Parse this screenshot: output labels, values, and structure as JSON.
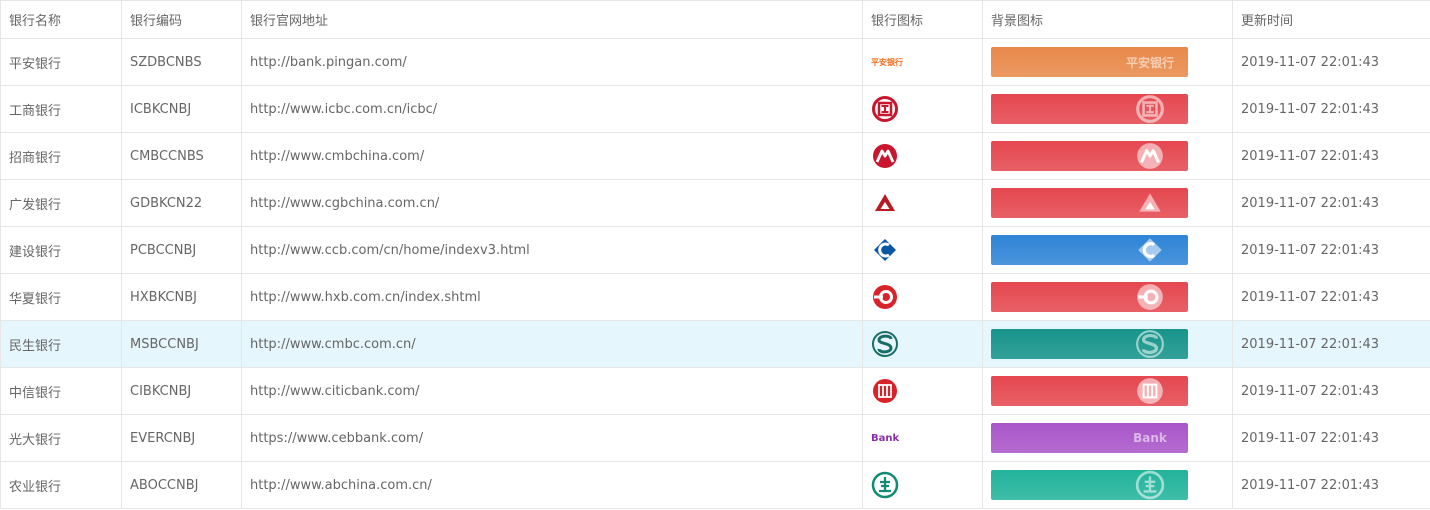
{
  "columns": [
    "银行名称",
    "银行编码",
    "银行官网地址",
    "银行图标",
    "背景图标",
    "更新时间"
  ],
  "rows": [
    {
      "name": "平安银行",
      "code": "SZDBCNBS",
      "url": "http://bank.pingan.com/",
      "icon": "pingan-logo-icon",
      "bg_color": "#e8894a",
      "time": "2019-11-07 22:01:43",
      "logo_text": "平安银行",
      "bg_text": "平安银行"
    },
    {
      "name": "工商银行",
      "code": "ICBKCNBJ",
      "url": "http://www.icbc.com.cn/icbc/",
      "icon": "icbc-logo-icon",
      "bg_color": "#e5474f",
      "time": "2019-11-07 22:01:43"
    },
    {
      "name": "招商银行",
      "code": "CMBCCNBS",
      "url": "http://www.cmbchina.com/",
      "icon": "cmb-logo-icon",
      "bg_color": "#e5474f",
      "time": "2019-11-07 22:01:43"
    },
    {
      "name": "广发银行",
      "code": "GDBKCN22",
      "url": "http://www.cgbchina.com.cn/",
      "icon": "cgb-logo-icon",
      "bg_color": "#e5474f",
      "time": "2019-11-07 22:01:43"
    },
    {
      "name": "建设银行",
      "code": "PCBCCNBJ",
      "url": "http://www.ccb.com/cn/home/indexv3.html",
      "icon": "ccb-logo-icon",
      "bg_color": "#2e84d6",
      "time": "2019-11-07 22:01:43"
    },
    {
      "name": "华夏银行",
      "code": "HXBKCNBJ",
      "url": "http://www.hxb.com.cn/index.shtml",
      "icon": "hxb-logo-icon",
      "bg_color": "#e5474f",
      "time": "2019-11-07 22:01:43"
    },
    {
      "name": "民生银行",
      "code": "MSBCCNBJ",
      "url": "http://www.cmbc.com.cn/",
      "icon": "cmbc-logo-icon",
      "bg_color": "#17948a",
      "time": "2019-11-07 22:01:43",
      "highlight": true
    },
    {
      "name": "中信银行",
      "code": "CIBKCNBJ",
      "url": "http://www.citicbank.com/",
      "icon": "citic-logo-icon",
      "bg_color": "#e5474f",
      "time": "2019-11-07 22:01:43"
    },
    {
      "name": "光大银行",
      "code": "EVERCNBJ",
      "url": "https://www.cebbank.com/",
      "icon": "ceb-logo-icon",
      "bg_color": "#a955c9",
      "time": "2019-11-07 22:01:43",
      "logo_text": "Bank",
      "bg_text": "Bank"
    },
    {
      "name": "农业银行",
      "code": "ABOCCNBJ",
      "url": "http://www.abchina.com.cn/",
      "icon": "abc-logo-icon",
      "bg_color": "#22b39b",
      "time": "2019-11-07 22:01:43"
    }
  ]
}
